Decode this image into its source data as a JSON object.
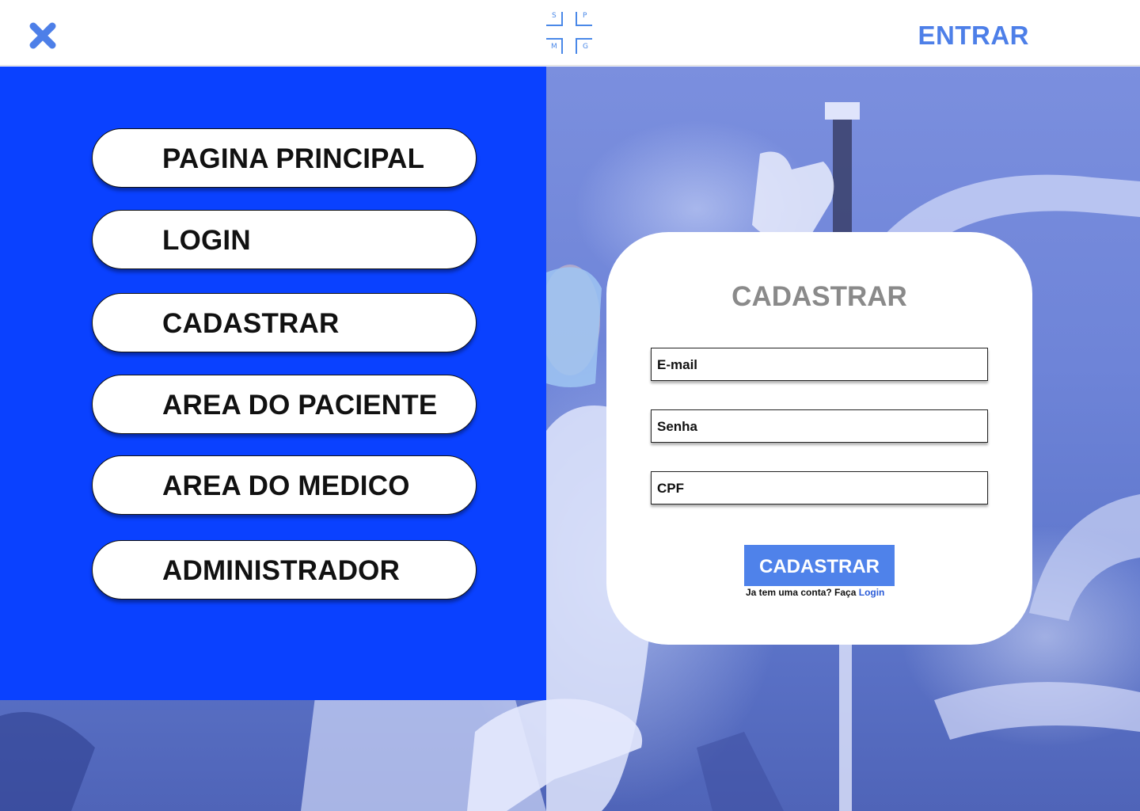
{
  "header": {
    "close_icon": "close-x-icon",
    "logo_letters": [
      "S",
      "P",
      "M",
      "G"
    ],
    "entrar_label": "ENTRAR",
    "accent_color": "#4d7fe8"
  },
  "menu": {
    "items": [
      {
        "label": "PAGINA PRINCIPAL"
      },
      {
        "label": "LOGIN"
      },
      {
        "label": "CADASTRAR"
      },
      {
        "label": "AREA DO PACIENTE"
      },
      {
        "label": "AREA DO MEDICO"
      },
      {
        "label": "ADMINISTRADOR"
      }
    ],
    "panel_color": "#0a41ff"
  },
  "register": {
    "title": "CADASTRAR",
    "fields": [
      {
        "placeholder": "E-mail"
      },
      {
        "placeholder": "Senha"
      },
      {
        "placeholder": "CPF"
      }
    ],
    "submit_label": "CADASTRAR",
    "hint_text": "Ja tem uma conta? Faça",
    "hint_link": "Login",
    "button_color": "#4f82ea"
  }
}
